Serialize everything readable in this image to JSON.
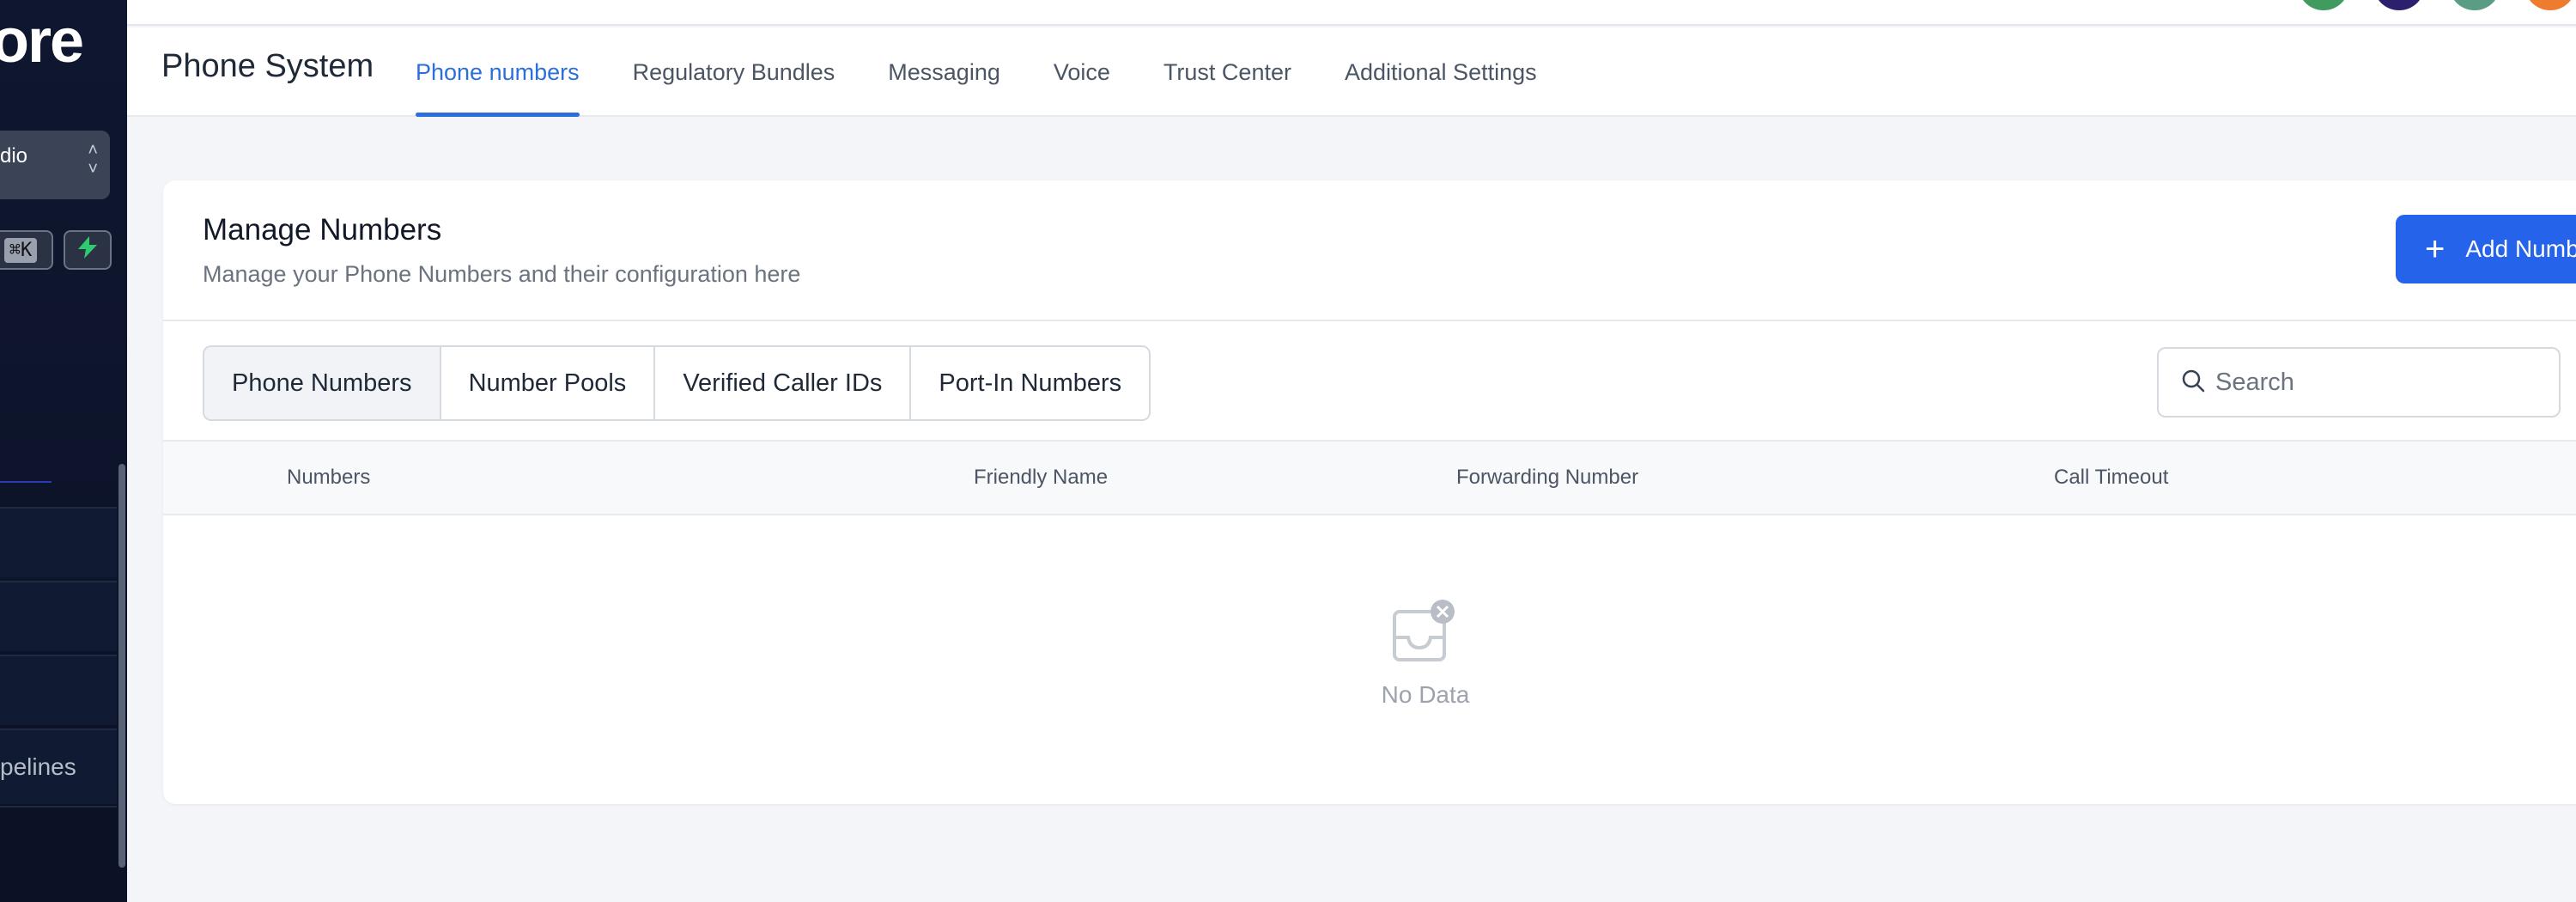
{
  "sidebar": {
    "brand": "ore",
    "account_label": "dio",
    "shortcut": "⌘K",
    "last_item_label": "pelines"
  },
  "header": {
    "title": "Phone System",
    "tabs": [
      {
        "label": "Phone numbers",
        "active": true
      },
      {
        "label": "Regulatory Bundles"
      },
      {
        "label": "Messaging"
      },
      {
        "label": "Voice"
      },
      {
        "label": "Trust Center"
      },
      {
        "label": "Additional Settings"
      }
    ]
  },
  "card": {
    "title": "Manage Numbers",
    "subtitle": "Manage your Phone Numbers and their configuration here",
    "add_button": "Add Numb",
    "subtabs": [
      {
        "label": "Phone Numbers",
        "active": true
      },
      {
        "label": "Number Pools"
      },
      {
        "label": "Verified Caller IDs"
      },
      {
        "label": "Port-In Numbers"
      }
    ],
    "search_placeholder": "Search",
    "columns": [
      "Numbers",
      "Friendly Name",
      "Forwarding Number",
      "Call Timeout"
    ],
    "empty_text": "No Data"
  },
  "colors": {
    "accent": "#2b6fdc",
    "primary_button": "#2563eb",
    "sidebar_bg": "#0f1730",
    "avatars": [
      "#3f9b5f",
      "#2b1f6e",
      "#5a9c84",
      "#ef7b2f"
    ]
  }
}
